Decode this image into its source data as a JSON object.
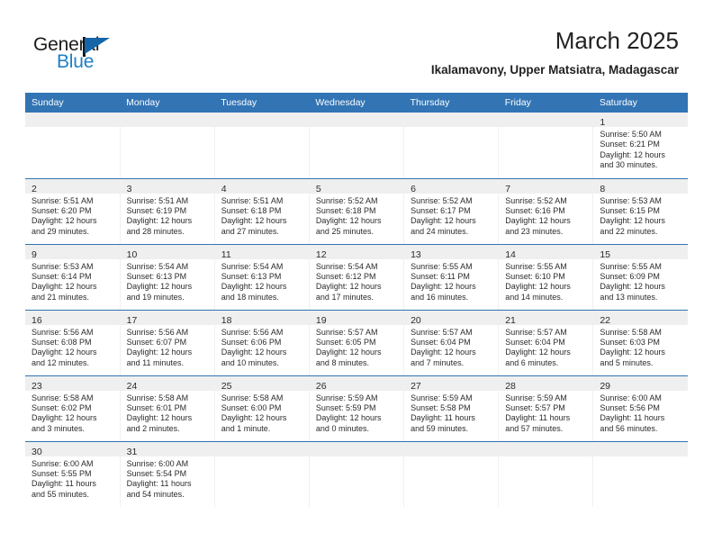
{
  "brand": {
    "name_part1": "General",
    "name_part2": "Blue",
    "flag_icon": "flag-triangle-icon",
    "accent_color": "#1f7fc4"
  },
  "header": {
    "title": "March 2025",
    "subtitle": "Ikalamavony, Upper Matsiatra, Madagascar"
  },
  "theme": {
    "header_blue": "#3274b4",
    "daynum_band": "#efefef",
    "text": "#2b2b2b"
  },
  "weekdays": [
    "Sunday",
    "Monday",
    "Tuesday",
    "Wednesday",
    "Thursday",
    "Friday",
    "Saturday"
  ],
  "weeks": [
    [
      {
        "day": "",
        "empty": true,
        "lines": []
      },
      {
        "day": "",
        "empty": true,
        "lines": []
      },
      {
        "day": "",
        "empty": true,
        "lines": []
      },
      {
        "day": "",
        "empty": true,
        "lines": []
      },
      {
        "day": "",
        "empty": true,
        "lines": []
      },
      {
        "day": "",
        "empty": true,
        "lines": []
      },
      {
        "day": "1",
        "empty": false,
        "lines": [
          "Sunrise: 5:50 AM",
          "Sunset: 6:21 PM",
          "Daylight: 12 hours",
          "and 30 minutes."
        ]
      }
    ],
    [
      {
        "day": "2",
        "empty": false,
        "lines": [
          "Sunrise: 5:51 AM",
          "Sunset: 6:20 PM",
          "Daylight: 12 hours",
          "and 29 minutes."
        ]
      },
      {
        "day": "3",
        "empty": false,
        "lines": [
          "Sunrise: 5:51 AM",
          "Sunset: 6:19 PM",
          "Daylight: 12 hours",
          "and 28 minutes."
        ]
      },
      {
        "day": "4",
        "empty": false,
        "lines": [
          "Sunrise: 5:51 AM",
          "Sunset: 6:18 PM",
          "Daylight: 12 hours",
          "and 27 minutes."
        ]
      },
      {
        "day": "5",
        "empty": false,
        "lines": [
          "Sunrise: 5:52 AM",
          "Sunset: 6:18 PM",
          "Daylight: 12 hours",
          "and 25 minutes."
        ]
      },
      {
        "day": "6",
        "empty": false,
        "lines": [
          "Sunrise: 5:52 AM",
          "Sunset: 6:17 PM",
          "Daylight: 12 hours",
          "and 24 minutes."
        ]
      },
      {
        "day": "7",
        "empty": false,
        "lines": [
          "Sunrise: 5:52 AM",
          "Sunset: 6:16 PM",
          "Daylight: 12 hours",
          "and 23 minutes."
        ]
      },
      {
        "day": "8",
        "empty": false,
        "lines": [
          "Sunrise: 5:53 AM",
          "Sunset: 6:15 PM",
          "Daylight: 12 hours",
          "and 22 minutes."
        ]
      }
    ],
    [
      {
        "day": "9",
        "empty": false,
        "lines": [
          "Sunrise: 5:53 AM",
          "Sunset: 6:14 PM",
          "Daylight: 12 hours",
          "and 21 minutes."
        ]
      },
      {
        "day": "10",
        "empty": false,
        "lines": [
          "Sunrise: 5:54 AM",
          "Sunset: 6:13 PM",
          "Daylight: 12 hours",
          "and 19 minutes."
        ]
      },
      {
        "day": "11",
        "empty": false,
        "lines": [
          "Sunrise: 5:54 AM",
          "Sunset: 6:13 PM",
          "Daylight: 12 hours",
          "and 18 minutes."
        ]
      },
      {
        "day": "12",
        "empty": false,
        "lines": [
          "Sunrise: 5:54 AM",
          "Sunset: 6:12 PM",
          "Daylight: 12 hours",
          "and 17 minutes."
        ]
      },
      {
        "day": "13",
        "empty": false,
        "lines": [
          "Sunrise: 5:55 AM",
          "Sunset: 6:11 PM",
          "Daylight: 12 hours",
          "and 16 minutes."
        ]
      },
      {
        "day": "14",
        "empty": false,
        "lines": [
          "Sunrise: 5:55 AM",
          "Sunset: 6:10 PM",
          "Daylight: 12 hours",
          "and 14 minutes."
        ]
      },
      {
        "day": "15",
        "empty": false,
        "lines": [
          "Sunrise: 5:55 AM",
          "Sunset: 6:09 PM",
          "Daylight: 12 hours",
          "and 13 minutes."
        ]
      }
    ],
    [
      {
        "day": "16",
        "empty": false,
        "lines": [
          "Sunrise: 5:56 AM",
          "Sunset: 6:08 PM",
          "Daylight: 12 hours",
          "and 12 minutes."
        ]
      },
      {
        "day": "17",
        "empty": false,
        "lines": [
          "Sunrise: 5:56 AM",
          "Sunset: 6:07 PM",
          "Daylight: 12 hours",
          "and 11 minutes."
        ]
      },
      {
        "day": "18",
        "empty": false,
        "lines": [
          "Sunrise: 5:56 AM",
          "Sunset: 6:06 PM",
          "Daylight: 12 hours",
          "and 10 minutes."
        ]
      },
      {
        "day": "19",
        "empty": false,
        "lines": [
          "Sunrise: 5:57 AM",
          "Sunset: 6:05 PM",
          "Daylight: 12 hours",
          "and 8 minutes."
        ]
      },
      {
        "day": "20",
        "empty": false,
        "lines": [
          "Sunrise: 5:57 AM",
          "Sunset: 6:04 PM",
          "Daylight: 12 hours",
          "and 7 minutes."
        ]
      },
      {
        "day": "21",
        "empty": false,
        "lines": [
          "Sunrise: 5:57 AM",
          "Sunset: 6:04 PM",
          "Daylight: 12 hours",
          "and 6 minutes."
        ]
      },
      {
        "day": "22",
        "empty": false,
        "lines": [
          "Sunrise: 5:58 AM",
          "Sunset: 6:03 PM",
          "Daylight: 12 hours",
          "and 5 minutes."
        ]
      }
    ],
    [
      {
        "day": "23",
        "empty": false,
        "lines": [
          "Sunrise: 5:58 AM",
          "Sunset: 6:02 PM",
          "Daylight: 12 hours",
          "and 3 minutes."
        ]
      },
      {
        "day": "24",
        "empty": false,
        "lines": [
          "Sunrise: 5:58 AM",
          "Sunset: 6:01 PM",
          "Daylight: 12 hours",
          "and 2 minutes."
        ]
      },
      {
        "day": "25",
        "empty": false,
        "lines": [
          "Sunrise: 5:58 AM",
          "Sunset: 6:00 PM",
          "Daylight: 12 hours",
          "and 1 minute."
        ]
      },
      {
        "day": "26",
        "empty": false,
        "lines": [
          "Sunrise: 5:59 AM",
          "Sunset: 5:59 PM",
          "Daylight: 12 hours",
          "and 0 minutes."
        ]
      },
      {
        "day": "27",
        "empty": false,
        "lines": [
          "Sunrise: 5:59 AM",
          "Sunset: 5:58 PM",
          "Daylight: 11 hours",
          "and 59 minutes."
        ]
      },
      {
        "day": "28",
        "empty": false,
        "lines": [
          "Sunrise: 5:59 AM",
          "Sunset: 5:57 PM",
          "Daylight: 11 hours",
          "and 57 minutes."
        ]
      },
      {
        "day": "29",
        "empty": false,
        "lines": [
          "Sunrise: 6:00 AM",
          "Sunset: 5:56 PM",
          "Daylight: 11 hours",
          "and 56 minutes."
        ]
      }
    ],
    [
      {
        "day": "30",
        "empty": false,
        "lines": [
          "Sunrise: 6:00 AM",
          "Sunset: 5:55 PM",
          "Daylight: 11 hours",
          "and 55 minutes."
        ]
      },
      {
        "day": "31",
        "empty": false,
        "lines": [
          "Sunrise: 6:00 AM",
          "Sunset: 5:54 PM",
          "Daylight: 11 hours",
          "and 54 minutes."
        ]
      },
      {
        "day": "",
        "empty": true,
        "lines": []
      },
      {
        "day": "",
        "empty": true,
        "lines": []
      },
      {
        "day": "",
        "empty": true,
        "lines": []
      },
      {
        "day": "",
        "empty": true,
        "lines": []
      },
      {
        "day": "",
        "empty": true,
        "lines": []
      }
    ]
  ]
}
